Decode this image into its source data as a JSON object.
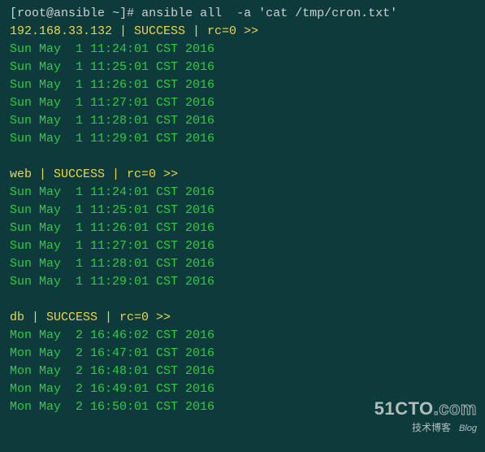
{
  "prompt": {
    "userhost": "root@ansible",
    "path": "~",
    "command": "ansible all  -a 'cat /tmp/cron.txt'"
  },
  "results": [
    {
      "header": "192.168.33.132 | SUCCESS | rc=0 >>",
      "lines": [
        "Sun May  1 11:24:01 CST 2016",
        "Sun May  1 11:25:01 CST 2016",
        "Sun May  1 11:26:01 CST 2016",
        "Sun May  1 11:27:01 CST 2016",
        "Sun May  1 11:28:01 CST 2016",
        "Sun May  1 11:29:01 CST 2016"
      ]
    },
    {
      "header": "web | SUCCESS | rc=0 >>",
      "lines": [
        "Sun May  1 11:24:01 CST 2016",
        "Sun May  1 11:25:01 CST 2016",
        "Sun May  1 11:26:01 CST 2016",
        "Sun May  1 11:27:01 CST 2016",
        "Sun May  1 11:28:01 CST 2016",
        "Sun May  1 11:29:01 CST 2016"
      ]
    },
    {
      "header": "db | SUCCESS | rc=0 >>",
      "lines": [
        "Mon May  2 16:46:02 CST 2016",
        "Mon May  2 16:47:01 CST 2016",
        "Mon May  2 16:48:01 CST 2016",
        "Mon May  2 16:49:01 CST 2016",
        "Mon May  2 16:50:01 CST 2016"
      ]
    }
  ],
  "watermark": {
    "brand_plain": "51CTO",
    "brand_outline": ".com",
    "sub1": "技术博客",
    "sub2": "Blog"
  }
}
